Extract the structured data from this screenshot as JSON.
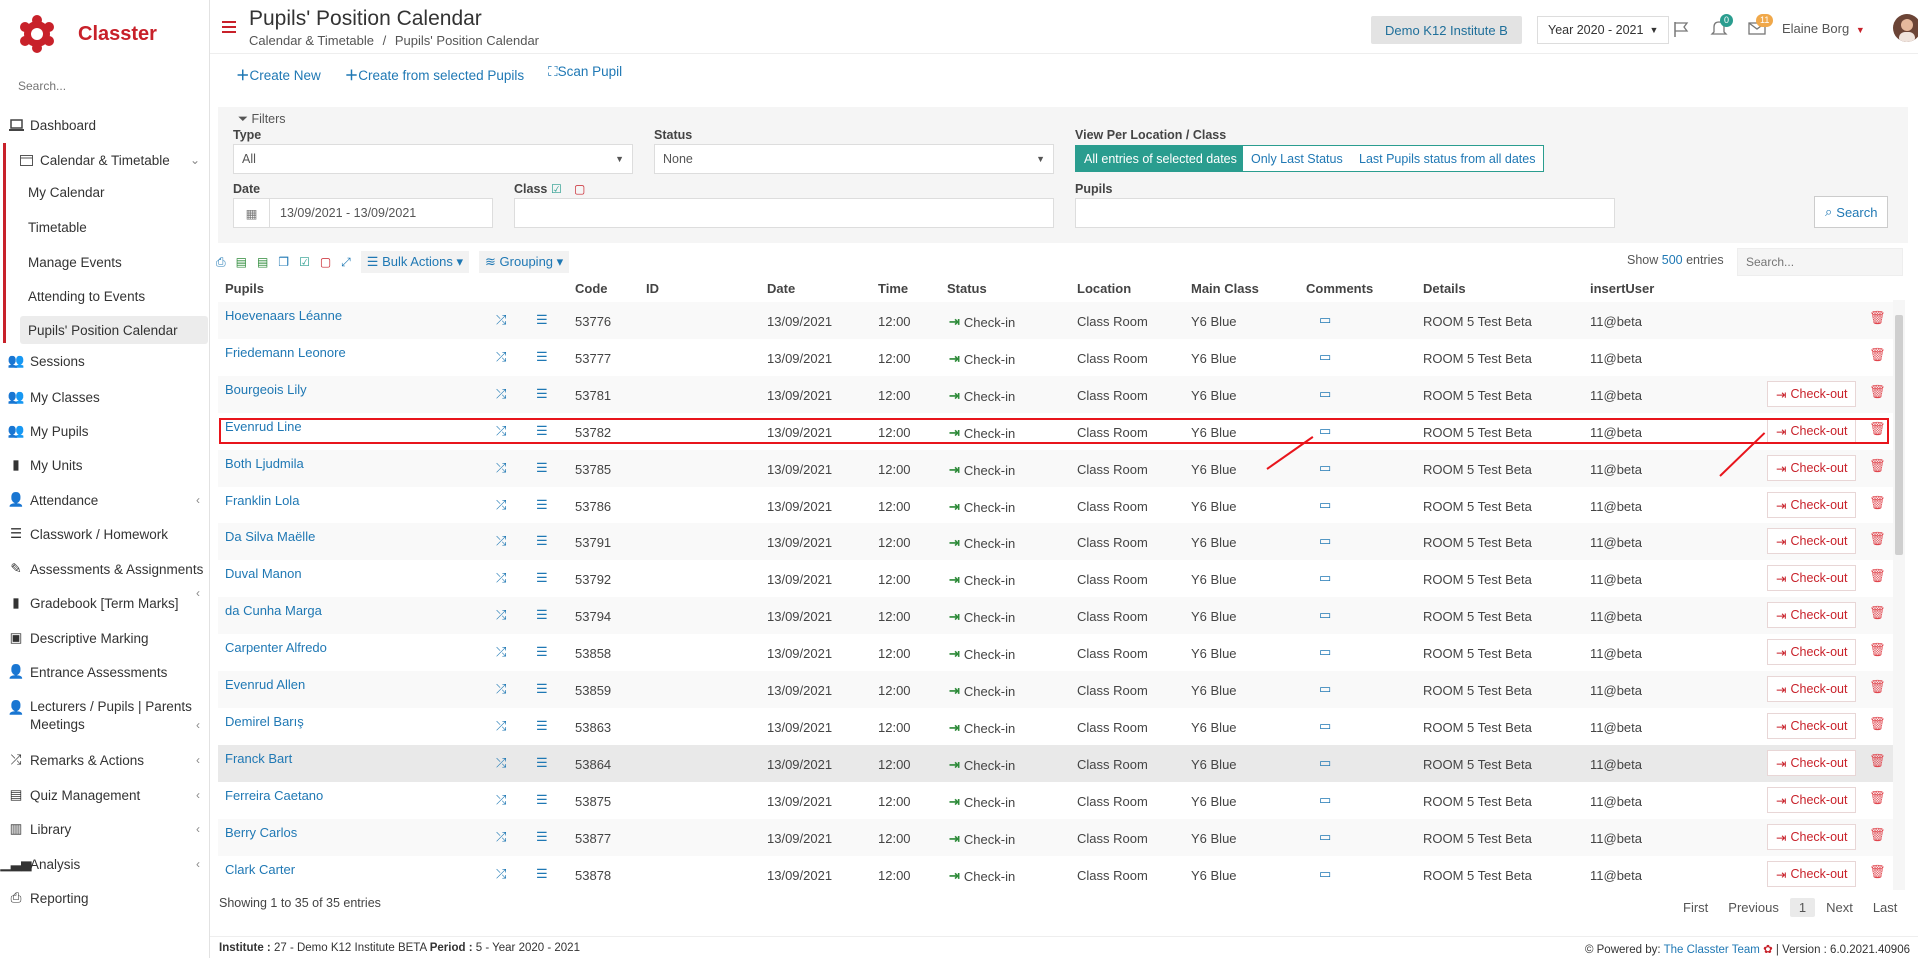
{
  "app": {
    "name": "Classter",
    "search_placeholder": "Search..."
  },
  "colors": {
    "brand": "#c8212a",
    "link": "#1f78b4",
    "success": "#2e8b3a",
    "accent_teal": "#2a9d8f"
  },
  "sidebar": {
    "items": [
      {
        "label": "Dashboard",
        "icon": "laptop-icon"
      },
      {
        "label": "Calendar & Timetable",
        "icon": "calendar-icon"
      },
      {
        "label": "Sessions",
        "icon": "users-icon"
      },
      {
        "label": "My Classes",
        "icon": "class-icon"
      },
      {
        "label": "My Pupils",
        "icon": "users-icon"
      },
      {
        "label": "My Units",
        "icon": "book-icon"
      },
      {
        "label": "Attendance",
        "icon": "user-check-icon"
      },
      {
        "label": "Classwork / Homework",
        "icon": "list-icon"
      },
      {
        "label": "Assessments & Assignments",
        "icon": "edit-icon"
      },
      {
        "label": "Gradebook [Term Marks]",
        "icon": "book-icon"
      },
      {
        "label": "Descriptive Marking",
        "icon": "marking-icon"
      },
      {
        "label": "Entrance Assessments",
        "icon": "user-edit-icon"
      },
      {
        "label": "Lecturers / Pupils | Parents Meetings",
        "icon": "meeting-icon"
      },
      {
        "label": "Remarks & Actions",
        "icon": "random-icon"
      },
      {
        "label": "Quiz Management",
        "icon": "quiz-icon"
      },
      {
        "label": "Library",
        "icon": "library-icon"
      },
      {
        "label": "Analysis",
        "icon": "chart-icon"
      },
      {
        "label": "Reporting",
        "icon": "print-icon"
      }
    ],
    "subitems": [
      {
        "label": "My Calendar"
      },
      {
        "label": "Timetable"
      },
      {
        "label": "Manage Events"
      },
      {
        "label": "Attending to Events"
      },
      {
        "label": "Pupils' Position Calendar"
      }
    ]
  },
  "header": {
    "title": "Pupils' Position Calendar",
    "breadcrumb_parent": "Calendar & Timetable",
    "breadcrumb_sep": "/",
    "breadcrumb_current": "Pupils' Position Calendar",
    "institute": "Demo K12 Institute B",
    "year": "Year 2020 - 2021",
    "bell_count": "0",
    "mail_count": "11",
    "user": "Elaine Borg"
  },
  "actions": {
    "create_new": "Create New",
    "create_from": "Create from selected Pupils",
    "scan": "Scan Pupil"
  },
  "filters": {
    "title": "Filters",
    "type_label": "Type",
    "type_value": "All",
    "status_label": "Status",
    "status_value": "None",
    "view_label": "View Per Location / Class",
    "view_all": "All entries of selected dates",
    "view_last": "Only Last Status",
    "view_last_all": "Last Pupils status from all dates",
    "date_label": "Date",
    "date_value": "13/09/2021 - 13/09/2021",
    "class_label": "Class",
    "pupils_label": "Pupils",
    "search": "Search"
  },
  "toolbar": {
    "bulk": "Bulk Actions",
    "grouping": "Grouping",
    "show_pre": "Show",
    "show_count": "500",
    "show_post": "entries",
    "search_placeholder": "Search..."
  },
  "table": {
    "headers": [
      "Pupils",
      "Code",
      "ID",
      "Date",
      "Time",
      "Status",
      "Location",
      "Main Class",
      "Comments",
      "Details",
      "insertUser"
    ],
    "rows": [
      {
        "name": "Hoevenaars Léanne",
        "code": "53776",
        "date": "13/09/2021",
        "time": "12:00",
        "status": "Check-in",
        "location": "Class Room",
        "class": "Y6 Blue",
        "details": "ROOM 5 Test Beta",
        "user": "11@beta",
        "checkout": ""
      },
      {
        "name": "Friedemann Leonore",
        "code": "53777",
        "date": "13/09/2021",
        "time": "12:00",
        "status": "Check-in",
        "location": "Class Room",
        "class": "Y6 Blue",
        "details": "ROOM 5 Test Beta",
        "user": "11@beta",
        "checkout": ""
      },
      {
        "name": "Bourgeois Lily",
        "code": "53781",
        "date": "13/09/2021",
        "time": "12:00",
        "status": "Check-in",
        "location": "Class Room",
        "class": "Y6 Blue",
        "details": "ROOM 5 Test Beta",
        "user": "11@beta",
        "checkout": "Check-out"
      },
      {
        "name": "Evenrud Line",
        "code": "53782",
        "date": "13/09/2021",
        "time": "12:00",
        "status": "Check-in",
        "location": "Class Room",
        "class": "Y6 Blue",
        "details": "ROOM 5 Test Beta",
        "user": "11@beta",
        "checkout": "Check-out"
      },
      {
        "name": "Both Ljudmila",
        "code": "53785",
        "date": "13/09/2021",
        "time": "12:00",
        "status": "Check-in",
        "location": "Class Room",
        "class": "Y6 Blue",
        "details": "ROOM 5 Test Beta",
        "user": "11@beta",
        "checkout": "Check-out"
      },
      {
        "name": "Franklin Lola",
        "code": "53786",
        "date": "13/09/2021",
        "time": "12:00",
        "status": "Check-in",
        "location": "Class Room",
        "class": "Y6 Blue",
        "details": "ROOM 5 Test Beta",
        "user": "11@beta",
        "checkout": "Check-out"
      },
      {
        "name": "Da Silva Maëlle",
        "code": "53791",
        "date": "13/09/2021",
        "time": "12:00",
        "status": "Check-in",
        "location": "Class Room",
        "class": "Y6 Blue",
        "details": "ROOM 5 Test Beta",
        "user": "11@beta",
        "checkout": "Check-out"
      },
      {
        "name": "Duval Manon",
        "code": "53792",
        "date": "13/09/2021",
        "time": "12:00",
        "status": "Check-in",
        "location": "Class Room",
        "class": "Y6 Blue",
        "details": "ROOM 5 Test Beta",
        "user": "11@beta",
        "checkout": "Check-out"
      },
      {
        "name": "da Cunha Marga",
        "code": "53794",
        "date": "13/09/2021",
        "time": "12:00",
        "status": "Check-in",
        "location": "Class Room",
        "class": "Y6 Blue",
        "details": "ROOM 5 Test Beta",
        "user": "11@beta",
        "checkout": "Check-out"
      },
      {
        "name": "Carpenter Alfredo",
        "code": "53858",
        "date": "13/09/2021",
        "time": "12:00",
        "status": "Check-in",
        "location": "Class Room",
        "class": "Y6 Blue",
        "details": "ROOM 5 Test Beta",
        "user": "11@beta",
        "checkout": "Check-out"
      },
      {
        "name": "Evenrud Allen",
        "code": "53859",
        "date": "13/09/2021",
        "time": "12:00",
        "status": "Check-in",
        "location": "Class Room",
        "class": "Y6 Blue",
        "details": "ROOM 5 Test Beta",
        "user": "11@beta",
        "checkout": "Check-out"
      },
      {
        "name": "Demirel Barış",
        "code": "53863",
        "date": "13/09/2021",
        "time": "12:00",
        "status": "Check-in",
        "location": "Class Room",
        "class": "Y6 Blue",
        "details": "ROOM 5 Test Beta",
        "user": "11@beta",
        "checkout": "Check-out"
      },
      {
        "name": "Franck Bart",
        "code": "53864",
        "date": "13/09/2021",
        "time": "12:00",
        "status": "Check-in",
        "location": "Class Room",
        "class": "Y6 Blue",
        "details": "ROOM 5 Test Beta",
        "user": "11@beta",
        "checkout": "Check-out"
      },
      {
        "name": "Ferreira Caetano",
        "code": "53875",
        "date": "13/09/2021",
        "time": "12:00",
        "status": "Check-in",
        "location": "Class Room",
        "class": "Y6 Blue",
        "details": "ROOM 5 Test Beta",
        "user": "11@beta",
        "checkout": "Check-out"
      },
      {
        "name": "Berry Carlos",
        "code": "53877",
        "date": "13/09/2021",
        "time": "12:00",
        "status": "Check-in",
        "location": "Class Room",
        "class": "Y6 Blue",
        "details": "ROOM 5 Test Beta",
        "user": "11@beta",
        "checkout": "Check-out"
      },
      {
        "name": "Clark Carter",
        "code": "53878",
        "date": "13/09/2021",
        "time": "12:00",
        "status": "Check-in",
        "location": "Class Room",
        "class": "Y6 Blue",
        "details": "ROOM 5 Test Beta",
        "user": "11@beta",
        "checkout": "Check-out"
      }
    ]
  },
  "pagination": {
    "info": "Showing 1 to 35 of 35 entries",
    "first": "First",
    "previous": "Previous",
    "page": "1",
    "next": "Next",
    "last": "Last"
  },
  "footer": {
    "institute_label": "Institute :",
    "institute_value": "27 - Demo K12 Institute BETA",
    "period_label": "Period :",
    "period_value": "5 - Year 2020 - 2021",
    "powered": "Powered by:",
    "team": "The Classter Team",
    "version": "| Version : 6.0.2021.40906"
  }
}
